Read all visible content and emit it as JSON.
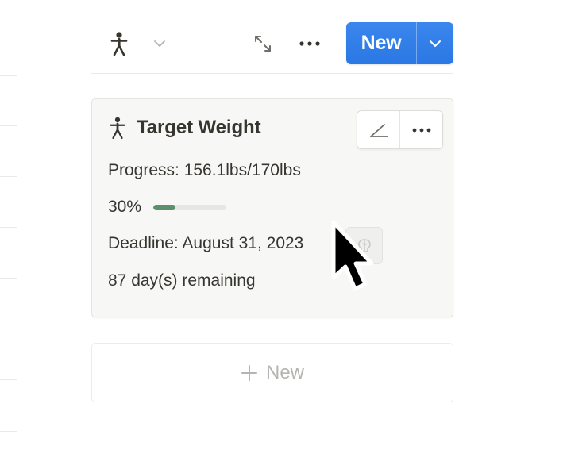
{
  "toolbar": {
    "view_icon": "person-icon",
    "view_dropdown_icon": "chevron-down-icon",
    "expand_icon": "expand-icon",
    "more_icon": "more-icon",
    "new_label": "New",
    "new_dropdown_icon": "chevron-down-icon"
  },
  "card": {
    "icon": "person-icon",
    "title": "Target Weight",
    "actions": {
      "edit_icon": "edit-icon",
      "more_icon": "more-icon"
    },
    "progress_text": "Progress: 156.1lbs/170lbs",
    "percent_text": "30%",
    "percent_value": 30,
    "deadline_text": "Deadline: August 31, 2023",
    "remaining_text": "87 day(s) remaining"
  },
  "add_new": {
    "plus_icon": "plus-icon",
    "label": "New"
  },
  "colors": {
    "accent": "#2f80ed",
    "progress": "#5e8f6c",
    "text": "#37352f",
    "muted": "#b4b4b0"
  }
}
